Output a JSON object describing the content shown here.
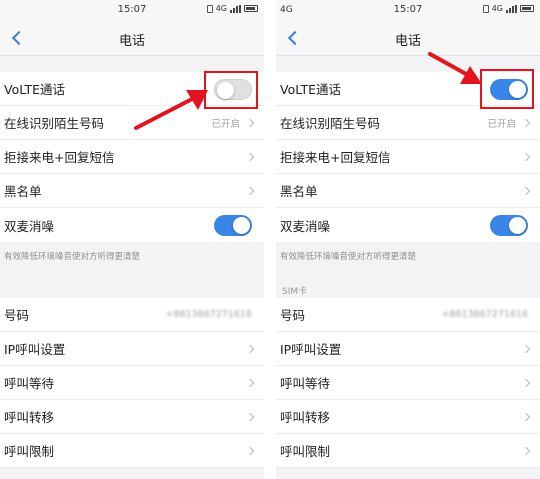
{
  "status": {
    "time": "15:07",
    "carrier_left": "",
    "carrier_right": "4G",
    "network": "4G"
  },
  "header": {
    "title": "电话"
  },
  "settings": {
    "volte_label": "VoLTE通话",
    "online_id_label": "在线识别陌生号码",
    "online_id_value": "已开启",
    "reject_reply_label": "拒接来电+回复短信",
    "blacklist_label": "黑名单",
    "dual_mic_label": "双麦消噪",
    "dual_mic_hint": "有效降低环境噪音使对方听得更清楚",
    "sim_header": "SIM卡",
    "number_label": "号码",
    "number_value": "+8613667271616",
    "ip_call_label": "IP呼叫设置",
    "call_waiting_label": "呼叫等待",
    "call_forward_label": "呼叫转移",
    "call_restrict_label": "呼叫限制"
  },
  "states": {
    "left_volte": "off",
    "right_volte": "on",
    "dual_mic": "on"
  },
  "colors": {
    "accent": "#3a85e8",
    "highlight": "#e3141f"
  }
}
